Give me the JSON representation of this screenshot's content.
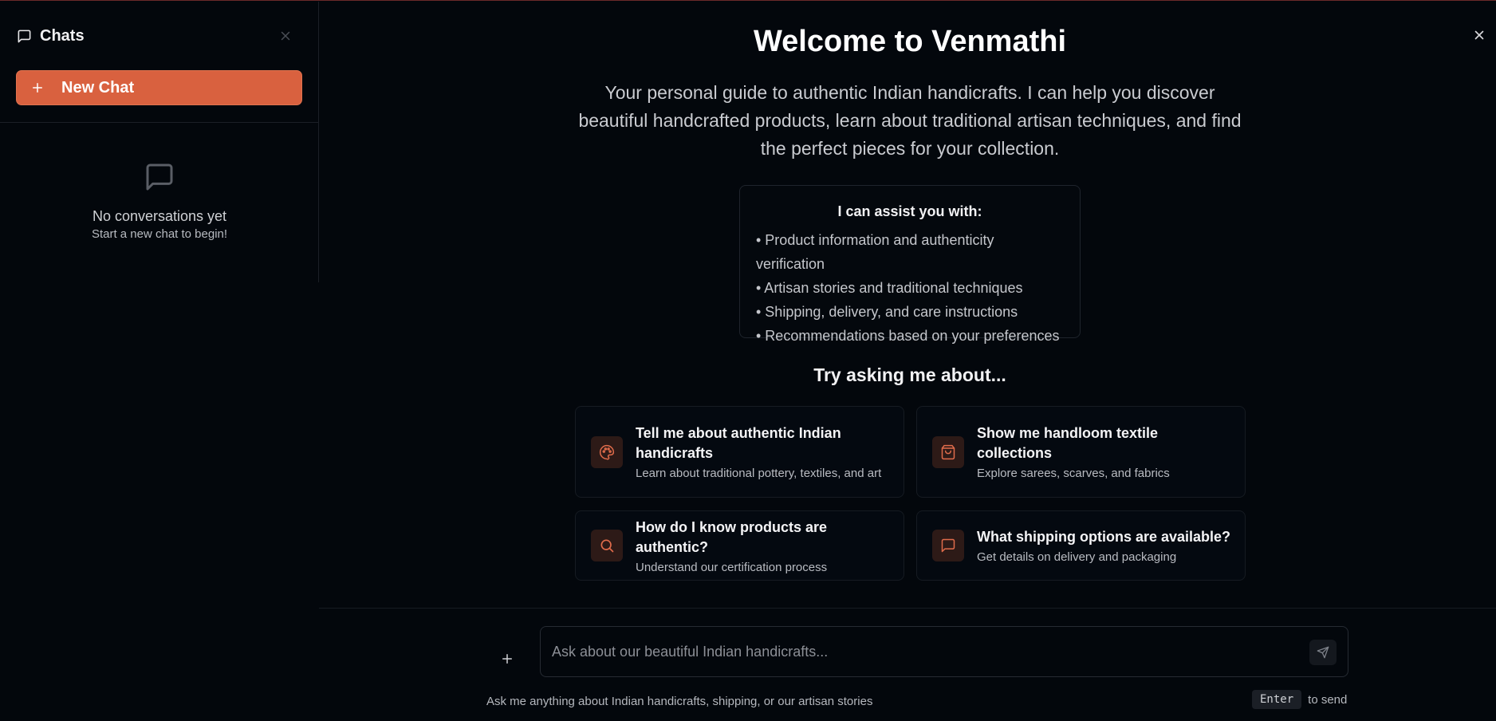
{
  "sidebar": {
    "title": "Chats",
    "new_chat_label": "New Chat",
    "empty_title": "No conversations yet",
    "empty_subtitle": "Start a new chat to begin!"
  },
  "main": {
    "welcome_title": "Welcome to Venmathi",
    "intro": "Your personal guide to authentic Indian handicrafts. I can help you discover beautiful handcrafted products, learn about traditional artisan techniques, and find the perfect pieces for your collection.",
    "assist": {
      "title": "I can assist you with:",
      "items": [
        "• Product information and authenticity verification",
        "• Artisan stories and traditional techniques",
        "• Shipping, delivery, and care instructions",
        "• Recommendations based on your preferences"
      ]
    },
    "try_title": "Try asking me about...",
    "suggestions": [
      {
        "title": "Tell me about authentic Indian handicrafts",
        "subtitle": "Learn about traditional pottery, textiles, and art",
        "icon": "palette-icon"
      },
      {
        "title": "Show me handloom textile collections",
        "subtitle": "Explore sarees, scarves, and fabrics",
        "icon": "shopping-bag-icon"
      },
      {
        "title": "How do I know products are authentic?",
        "subtitle": "Understand our certification process",
        "icon": "search-icon"
      },
      {
        "title": "What shipping options are available?",
        "subtitle": "Get details on delivery and packaging",
        "icon": "message-icon"
      }
    ]
  },
  "composer": {
    "placeholder": "Ask about our beautiful Indian handicrafts...",
    "hint": "Ask me anything about Indian handicrafts, shipping, or our artisan stories",
    "enter_key": "Enter",
    "enter_suffix": "to send"
  },
  "colors": {
    "accent": "#d9613f",
    "background": "#03070c",
    "icon_accent": "#e06c4b"
  }
}
